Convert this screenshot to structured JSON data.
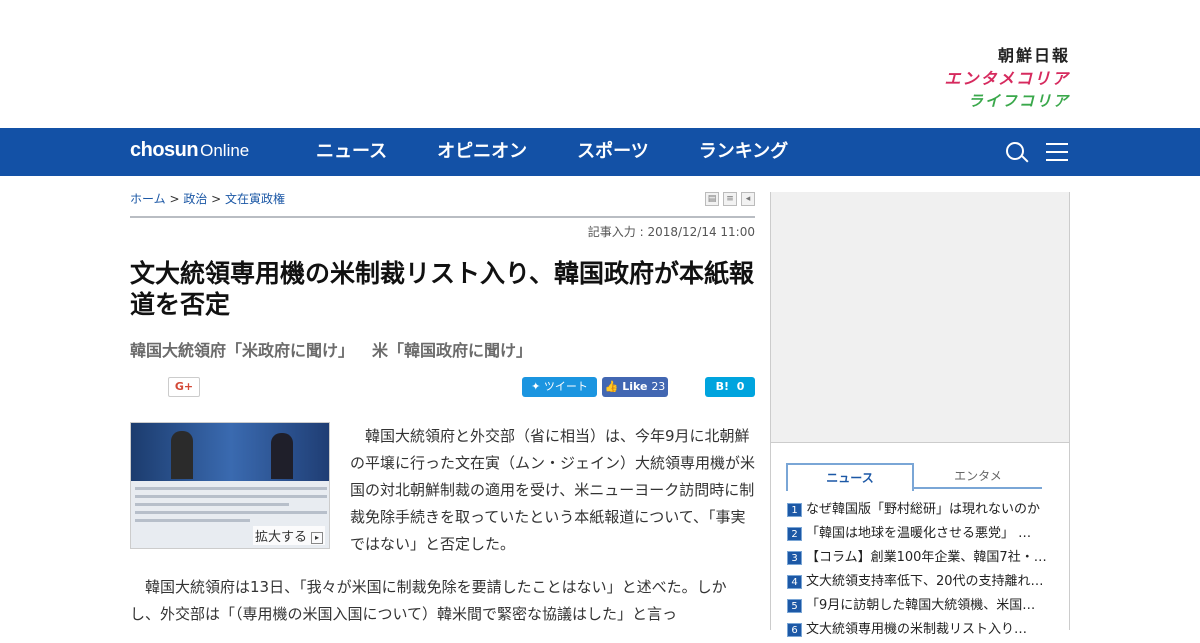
{
  "brands": {
    "chosunilbo": "朝鮮日報",
    "entame": "エンタメコリア",
    "life": "ライフコリア"
  },
  "nav": {
    "logo_bold": "chosun",
    "logo_light": "Online",
    "items": [
      "ニュース",
      "オピニオン",
      "スポーツ",
      "ランキング"
    ]
  },
  "breadcrumb": {
    "home": "ホーム",
    "sep1": " > ",
    "section": "政治",
    "sep2": " > ",
    "topic": "文在寅政権"
  },
  "article": {
    "date": "記事入力 : 2018/12/14 11:00",
    "headline": "文大統領専用機の米制裁リスト入り、韓国政府が本紙報道を否定",
    "subhead1": "韓国大統領府「米政府に聞け」",
    "subhead2": "米「韓国政府に聞け」",
    "photo_caption": "拡大する",
    "lead": "韓国大統領府と外交部（省に相当）は、今年9月に北朝鮮の平壌に行った文在寅（ムン・ジェイン）大統領専用機が米国の対北朝鮮制裁の適用を受け、米ニューヨーク訪問時に制裁免除手続きを取っていたという本紙報道について、「事実ではない」と否定した。",
    "para": "韓国大統領府は13日、「我々が米国に制裁免除を要請したことはない」と述べた。しかし、外交部は「（専用機の米国入国について）韓米間で緊密な協議はした」と言っ"
  },
  "social": {
    "gplus": "G+",
    "tweet": "ツイート",
    "like_label": "Like",
    "like_count": "23",
    "hatena_label": "B!",
    "hatena_count": "0"
  },
  "ranking": {
    "tabs": [
      "ニュース",
      "エンタメ"
    ],
    "items": [
      {
        "num": "1",
        "title": "なぜ韓国版「野村総研」は現れないのか"
      },
      {
        "num": "2",
        "title": "「韓国は地球を温暖化させる悪党」 …"
      },
      {
        "num": "3",
        "title": "【コラム】創業100年企業、韓国7社・…"
      },
      {
        "num": "4",
        "title": "文大統領支持率低下、20代の支持離れ…"
      },
      {
        "num": "5",
        "title": "「9月に訪朝した韓国大統領機、米国…"
      },
      {
        "num": "6",
        "title": "文大統領専用機の米制裁リスト入り…"
      }
    ]
  }
}
